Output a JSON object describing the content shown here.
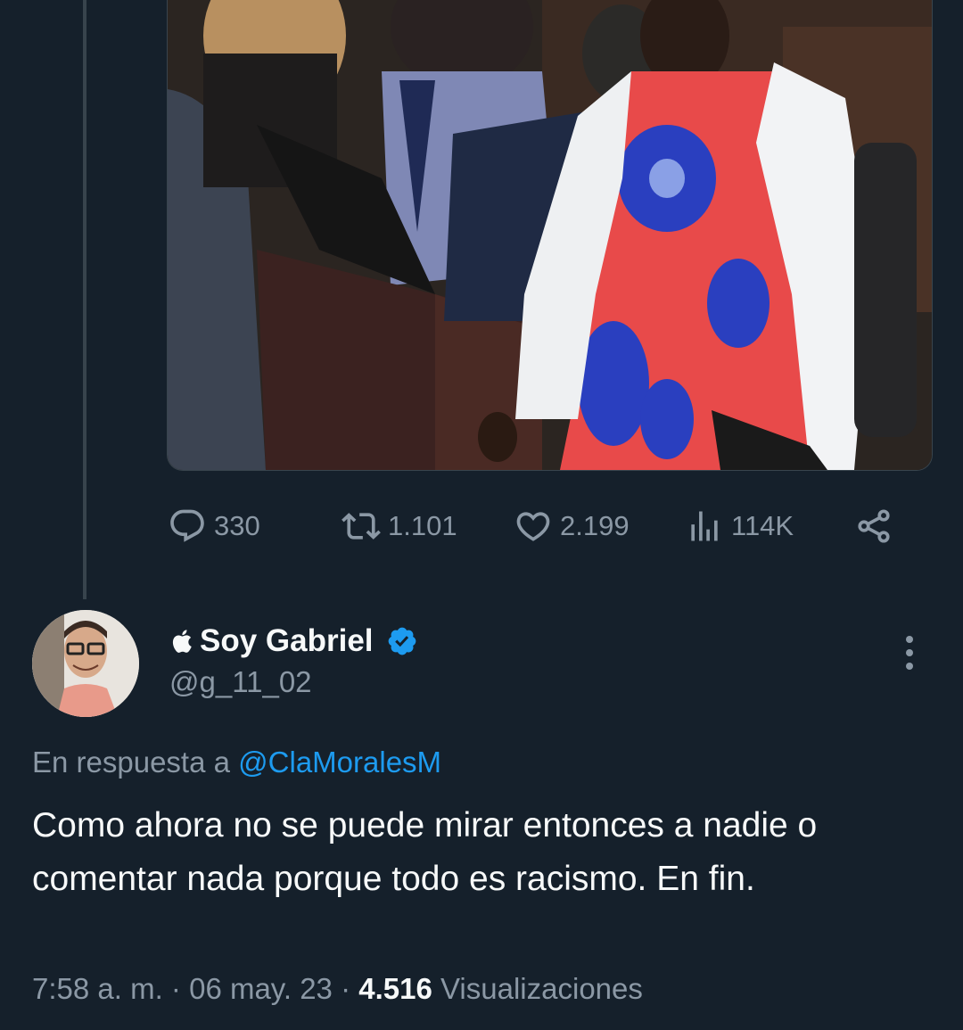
{
  "parent_tweet": {
    "stats": {
      "replies": "330",
      "retweets": "1.101",
      "likes": "2.199",
      "views": "114K"
    }
  },
  "reply_tweet": {
    "author": {
      "prefix_icon": "apple-icon",
      "display_name": "Soy Gabriel",
      "handle": "@g_11_02",
      "verified": true
    },
    "in_reply_to_label": "En respuesta a",
    "in_reply_to_handle": "@ClaMoralesM",
    "text": "Como ahora no se puede mirar entonces a nadie o comentar nada porque todo es racismo. En fin.",
    "time": "7:58 a. m.",
    "date": "06 may. 23",
    "separator": "·",
    "views_count": "4.516",
    "views_label": "Visualizaciones"
  },
  "colors": {
    "background": "#15202b",
    "secondary_text": "#8b98a5",
    "accent": "#1d9bf0"
  }
}
